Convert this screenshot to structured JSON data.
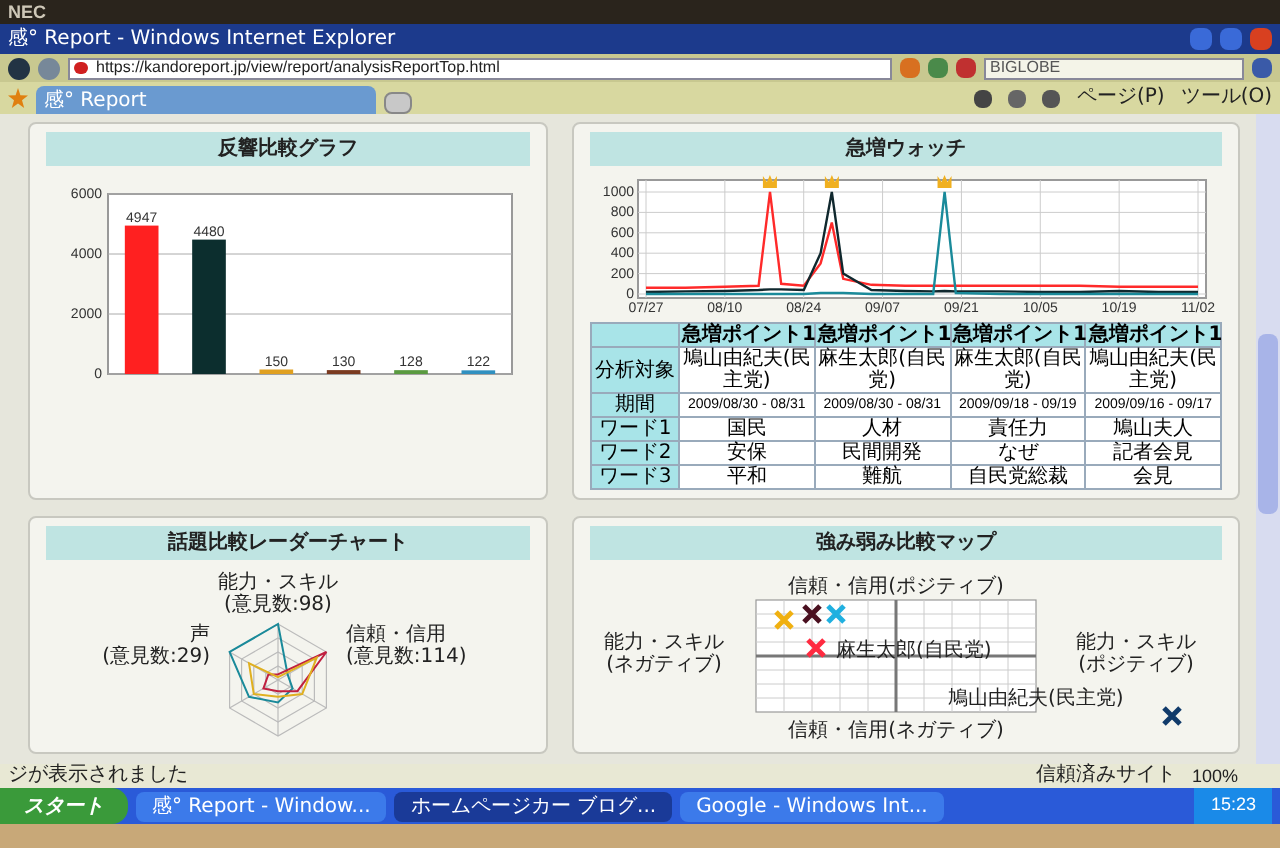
{
  "bezel": {
    "brand": "NEC"
  },
  "window": {
    "title": "感° Report - Windows Internet Explorer"
  },
  "address_bar": {
    "url": "https://kandoreport.jp/view/report/analysisReportTop.html",
    "search": "BIGLOBE"
  },
  "tabs": [
    {
      "label": "感° Report",
      "selected": true
    }
  ],
  "command_bar": {
    "page": "ページ(P)",
    "tools": "ツール(O)"
  },
  "panels": [
    {
      "kind": "bar",
      "title": "反響比較グラフ",
      "chart_data": {
        "type": "bar",
        "values": [
          4947,
          4480,
          150,
          130,
          128,
          122
        ],
        "colors": [
          "#ff2020",
          "#0c2e2e",
          "#e0a020",
          "#7a3a20",
          "#5a9a40",
          "#3090c0"
        ],
        "ylim": [
          0,
          6000
        ],
        "yticks": [
          0,
          2000,
          4000,
          6000
        ],
        "data_labels": true
      }
    },
    {
      "kind": "line",
      "title": "急増ウォッチ",
      "chart_data": {
        "type": "line",
        "x": [
          "2009-07-27",
          "2009-08-03",
          "2009-08-10",
          "2009-08-16",
          "2009-08-18",
          "2009-08-20",
          "2009-08-24",
          "2009-08-27",
          "2009-08-29",
          "2009-08-31",
          "2009-09-05",
          "2009-09-11",
          "2009-09-16",
          "2009-09-18",
          "2009-09-20",
          "2009-09-28",
          "2009-10-05",
          "2009-10-12",
          "2009-10-19",
          "2009-10-26",
          "2009-11-02"
        ],
        "series": [
          {
            "color": "#ff2a2a",
            "values": [
              60,
              60,
              70,
              80,
              1000,
              100,
              80,
              300,
              700,
              150,
              90,
              80,
              80,
              80,
              80,
              80,
              80,
              80,
              70,
              70,
              70
            ]
          },
          {
            "color": "#10282e",
            "values": [
              20,
              25,
              30,
              40,
              45,
              45,
              40,
              400,
              1000,
              200,
              40,
              30,
              25,
              30,
              25,
              25,
              20,
              20,
              30,
              20,
              20
            ]
          },
          {
            "color": "#1a8a9a",
            "values": [
              0,
              0,
              0,
              0,
              0,
              0,
              0,
              10,
              10,
              10,
              0,
              0,
              0,
              1000,
              10,
              0,
              0,
              0,
              0,
              0,
              0
            ]
          }
        ],
        "xlim": [
          "2009-07-27",
          "2009-11-02"
        ],
        "ylim": [
          0,
          1000
        ],
        "yticks": [
          0,
          200,
          400,
          600,
          800,
          1000
        ],
        "xticks": [
          {
            "value": "2009-07-27",
            "label": "07/27"
          },
          {
            "value": "2009-08-10",
            "label": "08/10"
          },
          {
            "value": "2009-08-24",
            "label": "08/24"
          },
          {
            "value": "2009-09-07",
            "label": "09/07"
          },
          {
            "value": "2009-09-21",
            "label": "09/21"
          },
          {
            "value": "2009-10-05",
            "label": "10/05"
          },
          {
            "value": "2009-10-19",
            "label": "10/19"
          },
          {
            "value": "2009-11-02",
            "label": "11/02"
          }
        ],
        "grid": true
      },
      "table": {
        "columns": [
          "急増ポイント1",
          "急増ポイント1",
          "急増ポイント1",
          "急増ポイント1"
        ],
        "rows": [
          {
            "label": "分析対象",
            "cells": [
              "鳩山由紀夫(民主党)",
              "麻生太郎(自民党)",
              "麻生太郎(自民党)",
              "鳩山由紀夫(民主党)"
            ]
          },
          {
            "label": "期間",
            "cells": [
              "2009/08/30 - 08/31",
              "2009/08/30 - 08/31",
              "2009/09/18 - 09/19",
              "2009/09/16 - 09/17"
            ]
          },
          {
            "label": "ワード1",
            "cells": [
              "国民",
              "人材",
              "責任力",
              "鳩山夫人"
            ]
          },
          {
            "label": "ワード2",
            "cells": [
              "安保",
              "民間開発",
              "なぜ",
              "記者会見"
            ]
          },
          {
            "label": "ワード3",
            "cells": [
              "平和",
              "難航",
              "自民党総裁",
              "会見"
            ]
          }
        ]
      }
    },
    {
      "kind": "radar",
      "title": "話題比較レーダーチャート",
      "axes": [
        {
          "label": "能力・スキル",
          "count": "(意見数:98)"
        },
        {
          "label": "声",
          "count": "(意見数:29)"
        },
        {
          "label": "信頼・信用",
          "count": "(意見数:114)"
        }
      ]
    },
    {
      "kind": "map",
      "title": "強み弱み比較マップ",
      "axes": {
        "top": "信頼・信用(ポジティブ)",
        "left": "能力・スキル (ネガティブ)",
        "right": "能力・スキル (ポジティブ)",
        "bottom": "信頼・信用(ネガティブ)"
      },
      "points": [
        {
          "color": "#4a1020"
        },
        {
          "color": "#20b0e0"
        },
        {
          "color": "#f0b010"
        },
        {
          "color": "#ff2a40",
          "label": "麻生太郎(自民党)"
        },
        {
          "color": "#103a6a",
          "label": "鳩山由紀夫(民主党)"
        }
      ]
    }
  ],
  "status_bar": {
    "message": "ジが表示されました",
    "zone": "信頼済みサイト",
    "zoom": "100%"
  },
  "taskbar": {
    "start": "スタート",
    "items": [
      {
        "label": "感° Report - Window...",
        "selected": false
      },
      {
        "label": "ホームページカー ブログ...",
        "selected": true
      },
      {
        "label": "Google - Windows Int...",
        "selected": false
      }
    ],
    "clock": "15:23"
  }
}
